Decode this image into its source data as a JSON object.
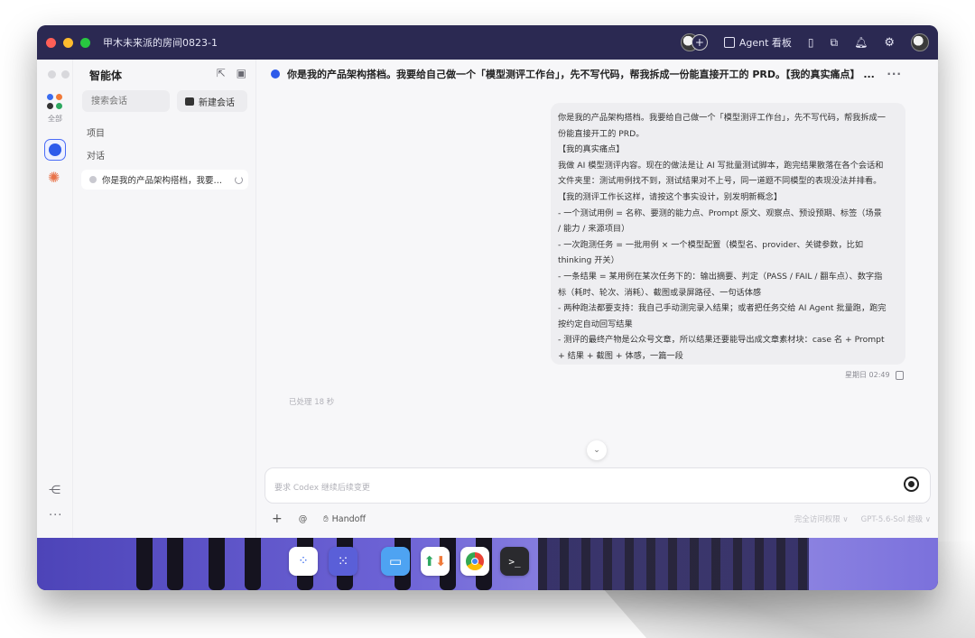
{
  "window": {
    "title": "甲木未来派的房间0823-1"
  },
  "titlebar": {
    "agent_board": "Agent 看板",
    "agent_icon": "board-icon"
  },
  "rail": {
    "all_label": "全部"
  },
  "sidebar": {
    "title": "智能体",
    "search_placeholder": "搜索会话",
    "new_chat": "新建会话",
    "section_projects": "项目",
    "section_conversations": "对话",
    "conversations": [
      {
        "label": "你是我的产品架构搭档，我要…"
      }
    ]
  },
  "thread": {
    "header": "你是我的产品架构搭档。我要给自己做一个「模型测评工作台」，先不写代码，帮我拆成一份能直接开工的 PRD。【我的真实痛点】 ...",
    "message_lines": [
      "你是我的产品架构搭档。我要给自己做一个「模型测评工作台」，先不写代码，帮我拆成一",
      "份能直接开工的 PRD。",
      "【我的真实痛点】",
      "我做 AI 模型测评内容。现在的做法是让 AI 写批量测试脚本，跑完结果散落在各个会话和",
      "文件夹里：测试用例找不到，测试结果对不上号，同一道题不同模型的表现没法并排看。",
      "【我的测评工作长这样，请按这个事实设计，别发明新概念】",
      "- 一个测试用例 = 名称、要测的能力点、Prompt 原文、观察点、预设预期、标签（场景",
      "/ 能力 / 来源项目）",
      "- 一次跑测任务 = 一批用例 × 一个模型配置（模型名、provider、关键参数，比如",
      "thinking 开关）",
      "- 一条结果 = 某用例在某次任务下的：输出摘要、判定（PASS / FAIL / 翻车点）、数字指",
      "标（耗时、轮次、消耗）、截图或录屏路径、一句话体感",
      "- 两种跑法都要支持：我自己手动测完录入结果；或者把任务交给 AI Agent 批量跑，跑完",
      "按约定自动回写结果",
      "- 测评的最终产物是公众号文章，所以结果还要能导出成文章素材块：case 名 + Prompt",
      "+ 结果 + 截图 + 体感，一篇一段"
    ],
    "message_time": "星期日 02:49",
    "processed": "已处理 18 秒"
  },
  "composer": {
    "placeholder": "要求 Codex 继续后续变更",
    "handoff": "Handoff",
    "access": "完全访问权限 ∨",
    "model": "GPT-5.6-Sol  超级 ∨"
  },
  "dock": {
    "apps": [
      "agents-app-icon",
      "multi-agent-app-icon",
      "finder-icon",
      "transfer-icon",
      "chrome-icon",
      "terminal-icon"
    ]
  },
  "colors": {
    "accent": "#2e5bea",
    "titlebar": "#2b2952",
    "bubble": "#eeeef1"
  }
}
